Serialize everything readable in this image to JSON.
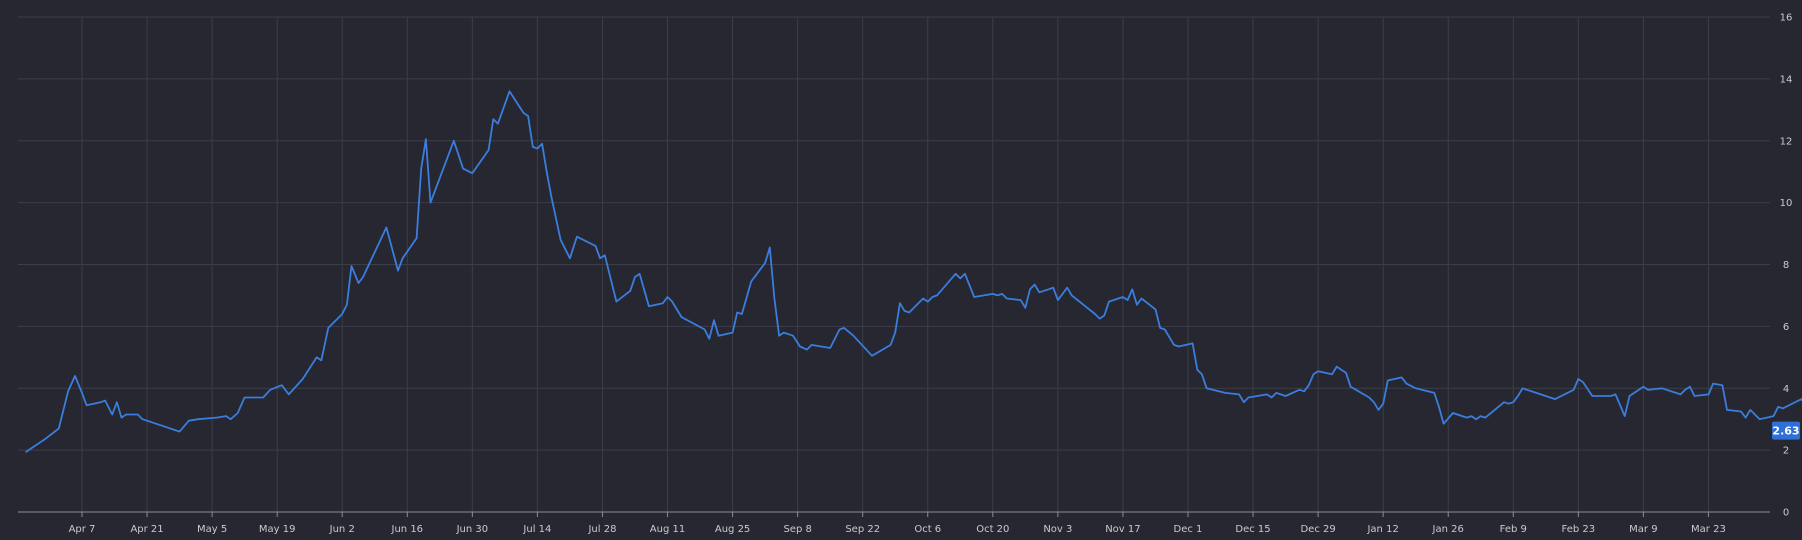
{
  "chart_data": {
    "type": "line",
    "title": "",
    "xlabel": "",
    "ylabel": "",
    "ylim": [
      0,
      16
    ],
    "y_ticks": [
      0,
      2,
      4,
      6,
      8,
      10,
      12,
      14,
      16
    ],
    "x_tick_labels": [
      "Apr 7",
      "Apr 21",
      "May 5",
      "May 19",
      "Jun 2",
      "Jun 16",
      "Jun 30",
      "Jul 14",
      "Jul 28",
      "Aug 11",
      "Aug 25",
      "Sep 8",
      "Sep 22",
      "Oct 6",
      "Oct 20",
      "Nov 3",
      "Nov 17",
      "Dec 1",
      "Dec 15",
      "Dec 29",
      "Jan 12",
      "Jan 26",
      "Feb 9",
      "Feb 23",
      "Mar 9",
      "Mar 23"
    ],
    "grid": true,
    "y_axis_position": "right",
    "last_value_label": "2.63",
    "colors": {
      "background": "#262730",
      "line": "#3b7ddd",
      "badge": "#2f6fd6"
    },
    "series": [
      {
        "points": [
          [
            -12,
            1.95
          ],
          [
            -8,
            2.35
          ],
          [
            -5,
            2.7
          ],
          [
            -3,
            3.9
          ],
          [
            -1.5,
            4.4
          ],
          [
            0,
            3.85
          ],
          [
            1,
            3.45
          ],
          [
            4,
            3.55
          ],
          [
            5,
            3.6
          ],
          [
            6.5,
            3.15
          ],
          [
            7.5,
            3.55
          ],
          [
            8.5,
            3.05
          ],
          [
            9.5,
            3.15
          ],
          [
            12,
            3.15
          ],
          [
            13,
            3.0
          ],
          [
            14,
            2.95
          ],
          [
            16,
            2.85
          ],
          [
            21,
            2.6
          ],
          [
            23,
            2.95
          ],
          [
            25,
            3.0
          ],
          [
            29,
            3.05
          ],
          [
            31,
            3.1
          ],
          [
            32,
            3.0
          ],
          [
            33.5,
            3.2
          ],
          [
            35,
            3.7
          ],
          [
            39,
            3.7
          ],
          [
            40.5,
            3.95
          ],
          [
            43,
            4.1
          ],
          [
            44.5,
            3.8
          ],
          [
            47.5,
            4.3
          ],
          [
            50.5,
            5.0
          ],
          [
            51.5,
            4.9
          ],
          [
            53,
            5.95
          ],
          [
            56,
            6.4
          ],
          [
            57,
            6.7
          ],
          [
            58,
            7.95
          ],
          [
            59.5,
            7.4
          ],
          [
            60.5,
            7.6
          ],
          [
            65.5,
            9.2
          ],
          [
            68,
            7.8
          ],
          [
            69,
            8.2
          ],
          [
            72,
            8.85
          ],
          [
            73,
            11.1
          ],
          [
            74,
            12.05
          ],
          [
            75,
            10.0
          ],
          [
            76.5,
            10.6
          ],
          [
            80,
            12.0
          ],
          [
            82,
            11.1
          ],
          [
            84,
            10.95
          ],
          [
            87.5,
            11.7
          ],
          [
            88.5,
            12.7
          ],
          [
            89.5,
            12.55
          ],
          [
            92,
            13.6
          ],
          [
            95,
            12.9
          ],
          [
            96,
            12.8
          ],
          [
            97,
            11.8
          ],
          [
            98,
            11.75
          ],
          [
            99,
            11.9
          ],
          [
            100,
            11.0
          ],
          [
            101,
            10.2
          ],
          [
            103,
            8.8
          ],
          [
            105,
            8.2
          ],
          [
            106.5,
            8.9
          ],
          [
            110.5,
            8.6
          ],
          [
            111.5,
            8.2
          ],
          [
            112.5,
            8.3
          ],
          [
            115,
            6.8
          ],
          [
            118,
            7.15
          ],
          [
            119,
            7.6
          ],
          [
            120,
            7.7
          ],
          [
            122,
            6.65
          ],
          [
            125,
            6.75
          ],
          [
            126,
            6.95
          ],
          [
            127,
            6.8
          ],
          [
            129,
            6.3
          ],
          [
            134,
            5.9
          ],
          [
            135,
            5.6
          ],
          [
            136,
            6.2
          ],
          [
            137,
            5.7
          ],
          [
            140,
            5.8
          ],
          [
            141,
            6.45
          ],
          [
            142,
            6.4
          ],
          [
            144,
            7.45
          ],
          [
            147,
            8.05
          ],
          [
            148,
            8.55
          ],
          [
            149,
            6.9
          ],
          [
            150,
            5.7
          ],
          [
            151,
            5.8
          ],
          [
            153,
            5.7
          ],
          [
            154.5,
            5.35
          ],
          [
            156,
            5.25
          ],
          [
            157,
            5.4
          ],
          [
            161,
            5.3
          ],
          [
            163,
            5.9
          ],
          [
            164,
            5.95
          ],
          [
            166,
            5.7
          ],
          [
            170,
            5.05
          ],
          [
            174,
            5.4
          ],
          [
            175,
            5.8
          ],
          [
            176,
            6.75
          ],
          [
            177,
            6.5
          ],
          [
            178,
            6.45
          ],
          [
            181,
            6.9
          ],
          [
            182,
            6.8
          ],
          [
            183,
            6.95
          ],
          [
            184,
            7.0
          ],
          [
            188,
            7.7
          ],
          [
            189,
            7.55
          ],
          [
            190,
            7.7
          ],
          [
            192,
            6.95
          ],
          [
            196,
            7.05
          ],
          [
            197,
            7.0
          ],
          [
            198,
            7.05
          ],
          [
            199,
            6.9
          ],
          [
            202,
            6.85
          ],
          [
            203,
            6.6
          ],
          [
            204,
            7.2
          ],
          [
            205,
            7.35
          ],
          [
            206,
            7.1
          ],
          [
            208,
            7.2
          ],
          [
            209,
            7.25
          ],
          [
            210,
            6.85
          ],
          [
            212,
            7.25
          ],
          [
            213,
            7.0
          ],
          [
            218,
            6.4
          ],
          [
            219,
            6.25
          ],
          [
            220,
            6.35
          ],
          [
            221,
            6.8
          ],
          [
            224,
            6.95
          ],
          [
            225,
            6.85
          ],
          [
            226,
            7.2
          ],
          [
            227,
            6.7
          ],
          [
            228,
            6.9
          ],
          [
            231,
            6.55
          ],
          [
            232,
            5.95
          ],
          [
            233,
            5.9
          ],
          [
            235,
            5.4
          ],
          [
            236,
            5.35
          ],
          [
            239,
            5.45
          ],
          [
            240,
            4.6
          ],
          [
            241,
            4.45
          ],
          [
            242,
            4.0
          ],
          [
            246,
            3.85
          ],
          [
            249,
            3.8
          ],
          [
            250,
            3.55
          ],
          [
            251,
            3.7
          ],
          [
            255,
            3.8
          ],
          [
            256,
            3.7
          ],
          [
            257,
            3.85
          ],
          [
            259,
            3.75
          ],
          [
            262,
            3.95
          ],
          [
            263,
            3.9
          ],
          [
            264,
            4.1
          ],
          [
            265,
            4.45
          ],
          [
            266,
            4.55
          ],
          [
            269,
            4.45
          ],
          [
            270,
            4.7
          ],
          [
            271,
            4.6
          ],
          [
            272,
            4.5
          ],
          [
            273,
            4.05
          ],
          [
            277,
            3.7
          ],
          [
            278,
            3.55
          ],
          [
            279,
            3.3
          ],
          [
            280,
            3.5
          ],
          [
            281,
            4.25
          ],
          [
            284,
            4.35
          ],
          [
            285,
            4.15
          ],
          [
            287,
            4.0
          ],
          [
            291,
            3.85
          ],
          [
            292,
            3.4
          ],
          [
            293,
            2.85
          ],
          [
            295,
            3.2
          ],
          [
            298,
            3.05
          ],
          [
            299,
            3.1
          ],
          [
            300,
            3.0
          ],
          [
            301,
            3.1
          ],
          [
            302,
            3.05
          ],
          [
            304,
            3.3
          ],
          [
            306,
            3.55
          ],
          [
            307,
            3.5
          ],
          [
            308,
            3.55
          ],
          [
            309,
            3.75
          ],
          [
            310,
            4.0
          ],
          [
            317,
            3.65
          ],
          [
            321,
            3.95
          ],
          [
            322,
            4.3
          ],
          [
            323,
            4.2
          ],
          [
            325,
            3.75
          ],
          [
            329,
            3.75
          ],
          [
            330,
            3.8
          ],
          [
            332,
            3.1
          ],
          [
            333,
            3.75
          ],
          [
            336,
            4.05
          ],
          [
            337,
            3.95
          ],
          [
            340,
            4.0
          ],
          [
            344,
            3.8
          ],
          [
            345,
            3.95
          ],
          [
            346,
            4.05
          ],
          [
            347,
            3.75
          ],
          [
            350,
            3.8
          ],
          [
            351,
            4.15
          ],
          [
            353,
            4.1
          ],
          [
            354,
            3.3
          ],
          [
            357,
            3.25
          ],
          [
            358,
            3.05
          ],
          [
            359,
            3.3
          ],
          [
            361,
            3.0
          ],
          [
            364,
            3.1
          ],
          [
            365,
            3.4
          ],
          [
            366,
            3.35
          ],
          [
            370,
            3.65
          ],
          [
            371,
            3.45
          ],
          [
            372,
            3.5
          ],
          [
            373,
            3.4
          ],
          [
            376,
            3.45
          ],
          [
            377,
            3.45
          ],
          [
            378,
            3.55
          ],
          [
            379,
            3.7
          ],
          [
            381,
            3.15
          ],
          [
            384,
            2.95
          ],
          [
            385,
            2.85
          ],
          [
            386,
            2.63
          ]
        ]
      }
    ]
  }
}
